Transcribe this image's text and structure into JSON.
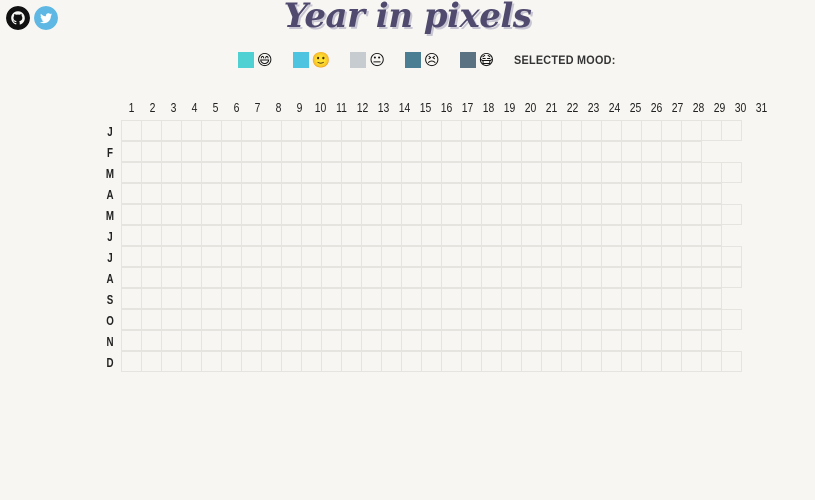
{
  "app": {
    "title": "Year in pixels"
  },
  "social": [
    {
      "name": "github-icon",
      "color": "#111111"
    },
    {
      "name": "twitter-icon",
      "color": "#5fb8e3"
    }
  ],
  "legend": {
    "moods": [
      {
        "color": "#4fd1d3",
        "emoji": "😄"
      },
      {
        "color": "#4ec4e0",
        "emoji": "🙂"
      },
      {
        "color": "#c6ccd0",
        "emoji": "😐"
      },
      {
        "color": "#4b7e93",
        "emoji": "😣"
      },
      {
        "color": "#5a7282",
        "emoji": "😷"
      }
    ],
    "selected_label": "SELECTED MOOD:"
  },
  "days": [
    "1",
    "2",
    "3",
    "4",
    "5",
    "6",
    "7",
    "8",
    "9",
    "10",
    "11",
    "12",
    "13",
    "14",
    "15",
    "16",
    "17",
    "18",
    "19",
    "20",
    "21",
    "22",
    "23",
    "24",
    "25",
    "26",
    "27",
    "28",
    "29",
    "30",
    "31"
  ],
  "months": [
    {
      "letter": "J",
      "days": 31
    },
    {
      "letter": "F",
      "days": 29
    },
    {
      "letter": "M",
      "days": 31
    },
    {
      "letter": "A",
      "days": 30
    },
    {
      "letter": "M",
      "days": 31
    },
    {
      "letter": "J",
      "days": 30
    },
    {
      "letter": "J",
      "days": 31
    },
    {
      "letter": "A",
      "days": 31
    },
    {
      "letter": "S",
      "days": 30
    },
    {
      "letter": "O",
      "days": 31
    },
    {
      "letter": "N",
      "days": 30
    },
    {
      "letter": "D",
      "days": 31
    }
  ]
}
